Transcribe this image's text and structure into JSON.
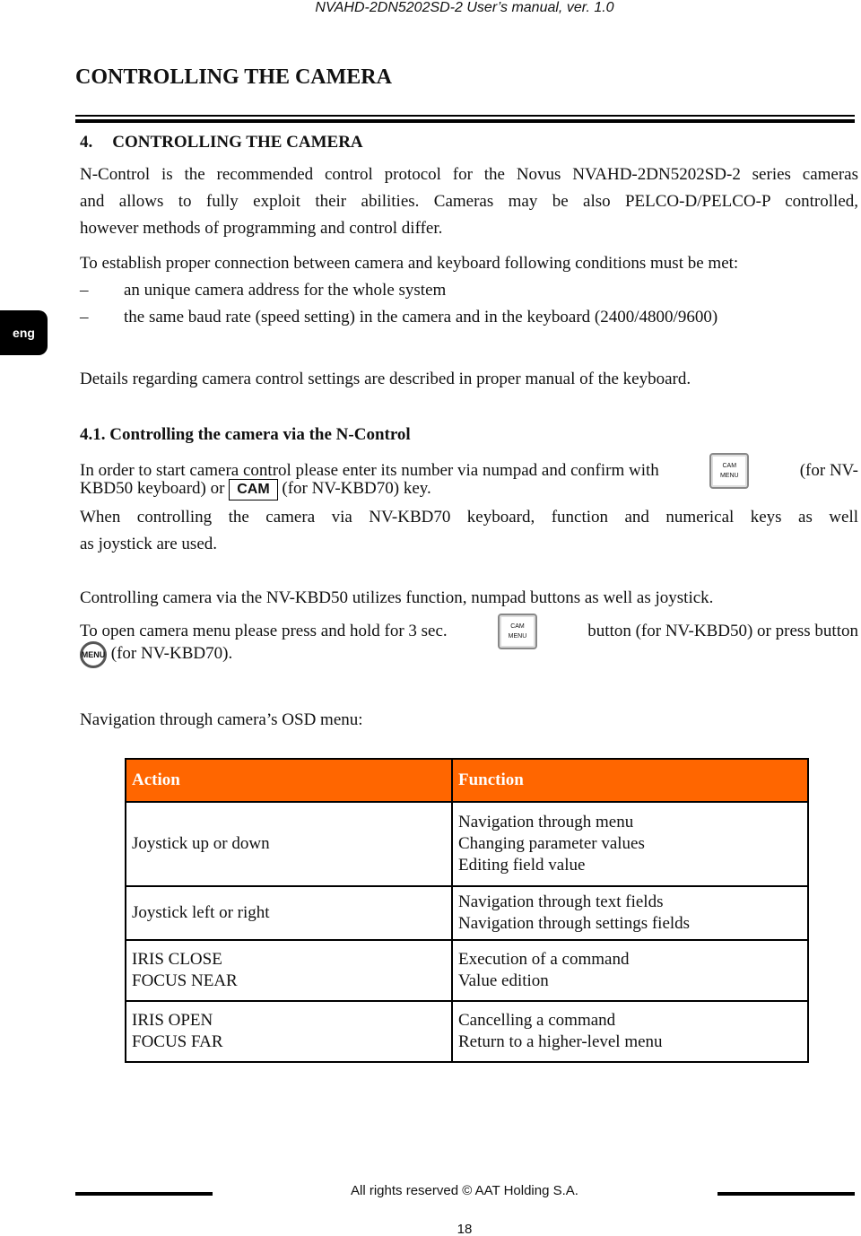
{
  "header": "NVAHD-2DN5202SD-2 User’s manual, ver. 1.0",
  "chapter_title": "CONTROLLING THE CAMERA",
  "side_tab": "eng",
  "section": {
    "number": "4.",
    "title": "CONTROLLING THE CAMERA"
  },
  "p1": [
    "N-Control is the recommended control protocol for the Novus NVAHD-2DN5202SD-2 series cameras",
    "and allows to fully exploit their abilities. Cameras may be also PELCO-D/PELCO-P controlled,",
    "however methods of programming and control differ."
  ],
  "p2": "To establish proper connection between camera and keyboard following conditions must be met:",
  "bullets": [
    "an unique camera address for the whole system",
    "the same baud rate (speed setting) in the camera and in the keyboard (2400/4800/9600)"
  ],
  "bullet_mark": "–",
  "p3": "Details regarding camera control settings are described in proper manual of the keyboard.",
  "subsection": {
    "number": "4.1.",
    "title": "Controlling the camera via the N-Control"
  },
  "p4": {
    "a": "In order to start camera control please enter its number via numpad and confirm with",
    "b": "(for NV-",
    "c": "KBD50 keyboard) or",
    "cam": "CAM",
    "d": "(for  NV-KBD70) key."
  },
  "key_cam_menu": {
    "top": "CAM",
    "bottom": "MENU"
  },
  "menu_key": "MENU",
  "p5": [
    "When controlling the camera via NV-KBD70  keyboard, function and numerical keys as well",
    "as joystick are used."
  ],
  "p6": "Controlling camera via the NV-KBD50 utilizes function, numpad buttons as well as joystick.",
  "p7": {
    "a": "To open camera menu please press and hold for 3 sec.",
    "b": "button (for NV-KBD50) or press button",
    "c": "(for  NV-KBD70)."
  },
  "p8": "Navigation through camera’s OSD menu:",
  "table": {
    "headers": [
      "Action",
      "Function"
    ],
    "rows": [
      {
        "action": [
          "Joystick up or down"
        ],
        "function": [
          "Navigation through menu",
          "Changing parameter values",
          "Editing field value"
        ]
      },
      {
        "action": [
          "Joystick left or right"
        ],
        "function": [
          "Navigation through text fields",
          "Navigation through settings fields"
        ]
      },
      {
        "action": [
          "IRIS CLOSE",
          "FOCUS NEAR"
        ],
        "function": [
          "Execution of a command",
          "Value edition"
        ]
      },
      {
        "action": [
          "IRIS OPEN",
          "FOCUS FAR"
        ],
        "function": [
          "Cancelling a command",
          "Return to a higher-level menu"
        ]
      }
    ],
    "header_color": "#ff6600"
  },
  "footer": "All rights reserved © AAT Holding S.A.",
  "page_number": "18"
}
